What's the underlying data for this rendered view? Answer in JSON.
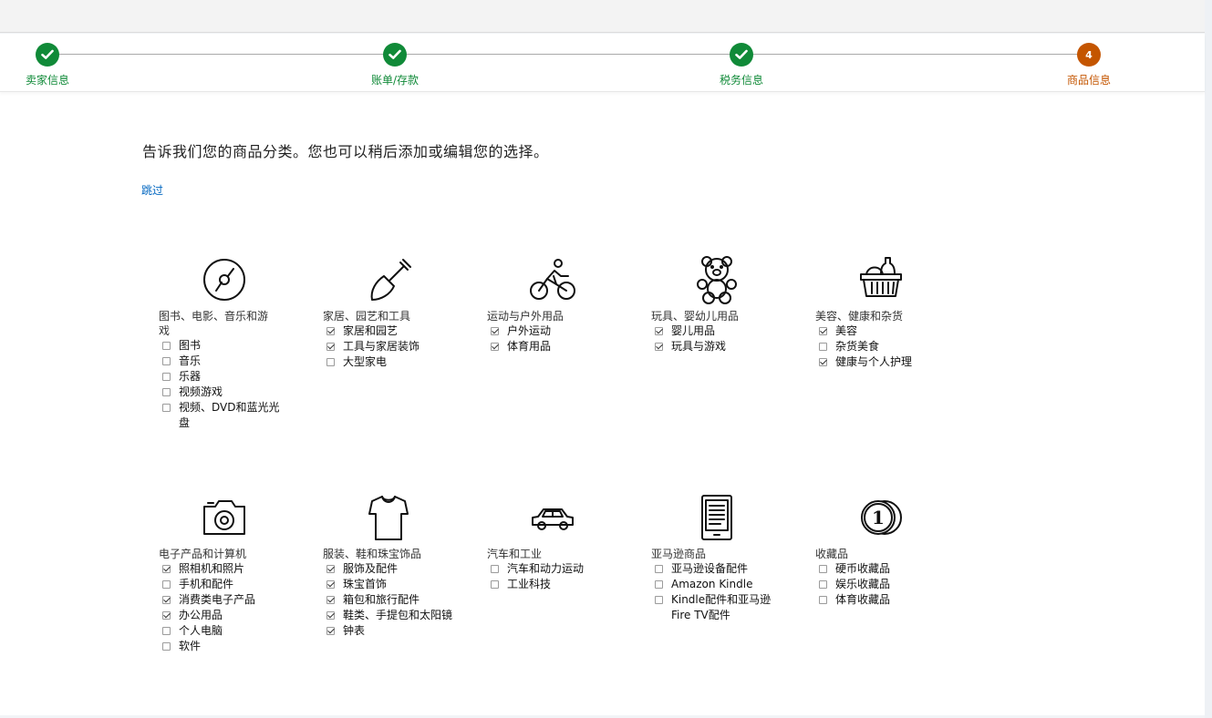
{
  "steps": [
    {
      "label": "卖家信息",
      "status": "done"
    },
    {
      "label": "账单/存款",
      "status": "done"
    },
    {
      "label": "税务信息",
      "status": "done"
    },
    {
      "label": "商品信息",
      "status": "current",
      "number": "4"
    }
  ],
  "heading": "告诉我们您的商品分类。您也可以稍后添加或编辑您的选择。",
  "skip_link": "跳过",
  "categories": [
    {
      "title": "图书、电影、音乐和游戏",
      "icon": "disc-icon",
      "items": [
        {
          "label": "图书",
          "checked": false
        },
        {
          "label": "音乐",
          "checked": false
        },
        {
          "label": "乐器",
          "checked": false
        },
        {
          "label": "视频游戏",
          "checked": false
        },
        {
          "label": "视频、DVD和蓝光光盘",
          "checked": false
        }
      ]
    },
    {
      "title": "家居、园艺和工具",
      "icon": "shovel-icon",
      "items": [
        {
          "label": "家居和园艺",
          "checked": true
        },
        {
          "label": "工具与家居装饰",
          "checked": true
        },
        {
          "label": "大型家电",
          "checked": false
        }
      ]
    },
    {
      "title": "运动与户外用品",
      "icon": "cyclist-icon",
      "items": [
        {
          "label": "户外运动",
          "checked": true
        },
        {
          "label": "体育用品",
          "checked": true
        }
      ]
    },
    {
      "title": "玩具、婴幼儿用品",
      "icon": "teddy-bear-icon",
      "items": [
        {
          "label": "婴儿用品",
          "checked": true
        },
        {
          "label": "玩具与游戏",
          "checked": true
        }
      ]
    },
    {
      "title": "美容、健康和杂货",
      "icon": "basket-icon",
      "items": [
        {
          "label": "美容",
          "checked": true
        },
        {
          "label": "杂货美食",
          "checked": false
        },
        {
          "label": "健康与个人护理",
          "checked": true
        }
      ]
    },
    {
      "title": "电子产品和计算机",
      "icon": "camera-icon",
      "items": [
        {
          "label": "照相机和照片",
          "checked": true
        },
        {
          "label": "手机和配件",
          "checked": false
        },
        {
          "label": "消费类电子产品",
          "checked": true
        },
        {
          "label": "办公用品",
          "checked": true
        },
        {
          "label": "个人电脑",
          "checked": false
        },
        {
          "label": "软件",
          "checked": false
        }
      ]
    },
    {
      "title": "服装、鞋和珠宝饰品",
      "icon": "tshirt-icon",
      "items": [
        {
          "label": "服饰及配件",
          "checked": true
        },
        {
          "label": "珠宝首饰",
          "checked": true
        },
        {
          "label": "箱包和旅行配件",
          "checked": true
        },
        {
          "label": "鞋类、手提包和太阳镜",
          "checked": true
        },
        {
          "label": "钟表",
          "checked": true
        }
      ]
    },
    {
      "title": "汽车和工业",
      "icon": "car-icon",
      "items": [
        {
          "label": "汽车和动力运动",
          "checked": false
        },
        {
          "label": "工业科技",
          "checked": false
        }
      ]
    },
    {
      "title": "亚马逊商品",
      "icon": "ereader-icon",
      "items": [
        {
          "label": "亚马逊设备配件",
          "checked": false
        },
        {
          "label": "Amazon Kindle",
          "checked": false
        },
        {
          "label": "Kindle配件和亚马逊Fire TV配件",
          "checked": false
        }
      ]
    },
    {
      "title": "收藏品",
      "icon": "coin-icon",
      "items": [
        {
          "label": "硬币收藏品",
          "checked": false
        },
        {
          "label": "娱乐收藏品",
          "checked": false
        },
        {
          "label": "体育收藏品",
          "checked": false
        }
      ]
    }
  ],
  "colors": {
    "done": "#108a38",
    "current": "#c45500",
    "link": "#0066c0"
  }
}
